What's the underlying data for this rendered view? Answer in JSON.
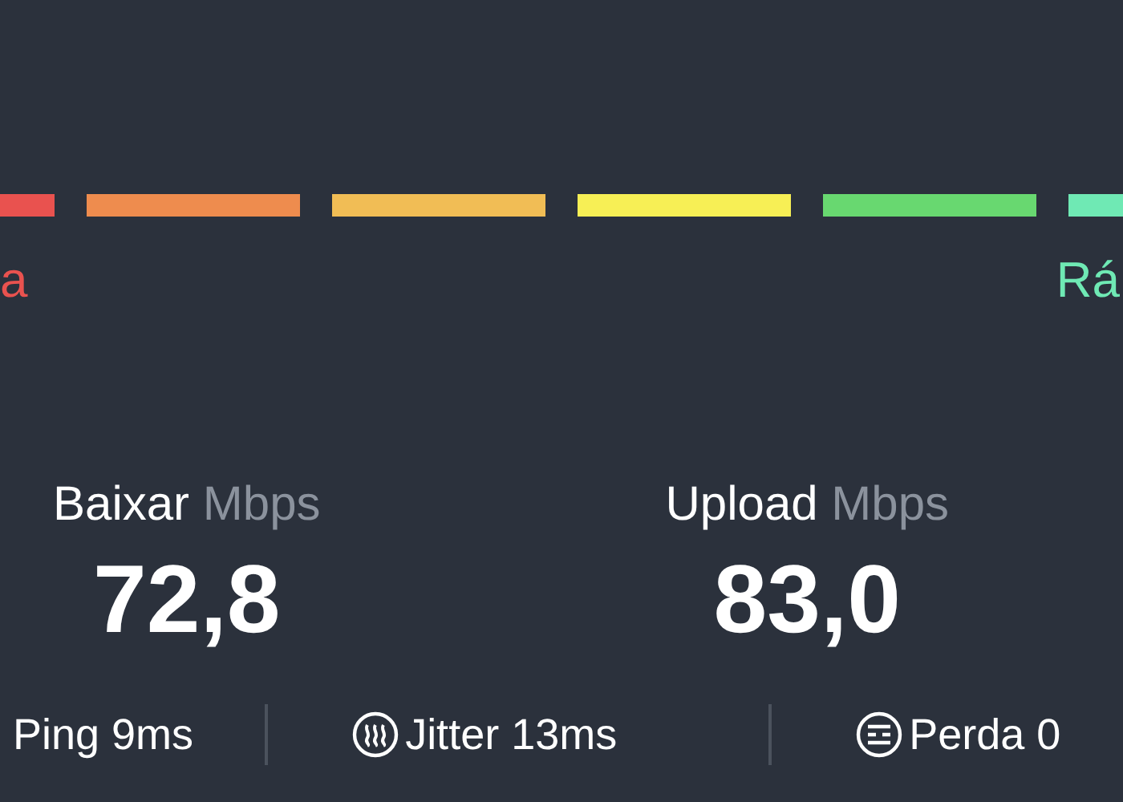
{
  "scale": {
    "segments": [
      {
        "color": "#e9524f"
      },
      {
        "color": "#ee8c4e"
      },
      {
        "color": "#f1bd55"
      },
      {
        "color": "#f7ef55"
      },
      {
        "color": "#68d870"
      },
      {
        "color": "#6fe9b4"
      }
    ],
    "low_label": {
      "text": "a",
      "color": "#e9524f"
    },
    "high_label": {
      "text": "Rá",
      "color": "#6fe9b4"
    }
  },
  "speeds": [
    {
      "label": "Baixar",
      "unit": "Mbps",
      "value": "72,8"
    },
    {
      "label": "Upload",
      "unit": "Mbps",
      "value": "83,0"
    }
  ],
  "metrics": [
    {
      "kind": "ping",
      "text": "Ping 9ms"
    },
    {
      "kind": "jitter",
      "text": "Jitter 13ms"
    },
    {
      "kind": "loss",
      "text": "Perda 0"
    }
  ]
}
